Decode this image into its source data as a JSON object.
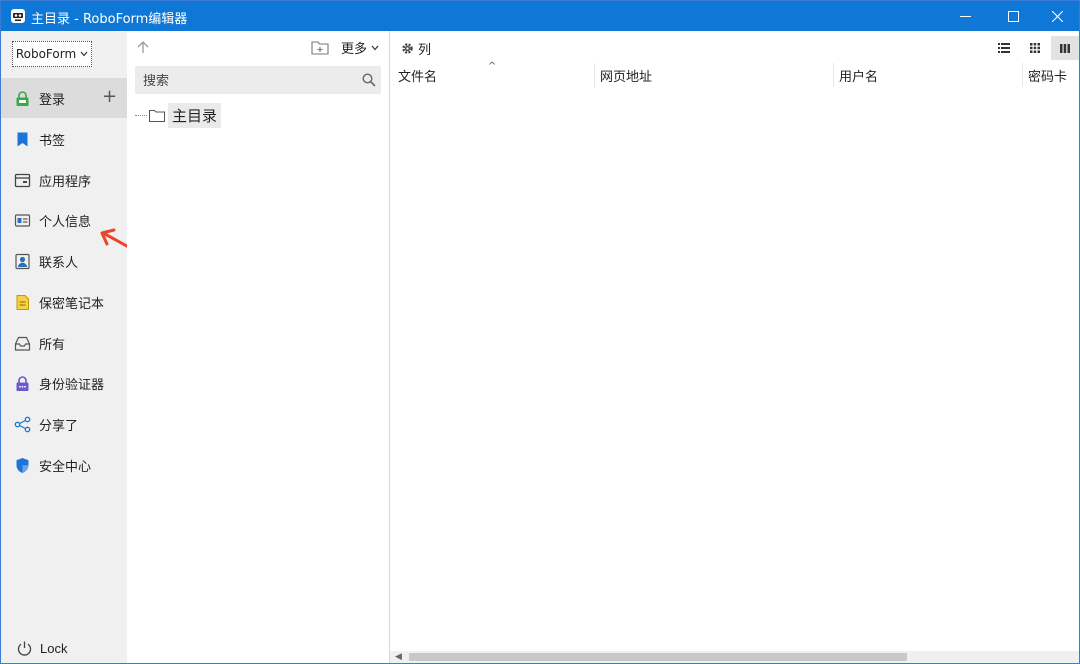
{
  "window": {
    "title": "主目录 - RoboForm编辑器"
  },
  "sidebar": {
    "profile_button": "RoboForm",
    "items": [
      {
        "label": "登录",
        "icon": "lock-login-icon",
        "color": "#3aa84a"
      },
      {
        "label": "书签",
        "icon": "bookmark-icon",
        "color": "#1e73d8"
      },
      {
        "label": "应用程序",
        "icon": "application-icon",
        "color": "#444444"
      },
      {
        "label": "个人信息",
        "icon": "identity-card-icon",
        "color": "#2f6fb8"
      },
      {
        "label": "联系人",
        "icon": "contact-icon",
        "color": "#2f6fb8"
      },
      {
        "label": "保密笔记本",
        "icon": "safenote-icon",
        "color": "#e8b800"
      },
      {
        "label": "所有",
        "icon": "inbox-all-icon",
        "color": "#555555"
      },
      {
        "label": "身份验证器",
        "icon": "authenticator-icon",
        "color": "#6a5acd"
      },
      {
        "label": "分享了",
        "icon": "share-icon",
        "color": "#1e73d8"
      },
      {
        "label": "安全中心",
        "icon": "security-shield-icon",
        "color": "#1e73d8"
      }
    ],
    "lock_label": "Lock"
  },
  "tree": {
    "more_label": "更多",
    "search_placeholder": "搜索",
    "root_label": "主目录"
  },
  "main": {
    "columns_button": "列",
    "headers": [
      "文件名",
      "网页地址",
      "用户名",
      "密码卡"
    ]
  },
  "colors": {
    "titlebar": "#0f78d7",
    "sidebar_bg": "#f0f0f0",
    "annotation_arrow": "#e8452c"
  }
}
